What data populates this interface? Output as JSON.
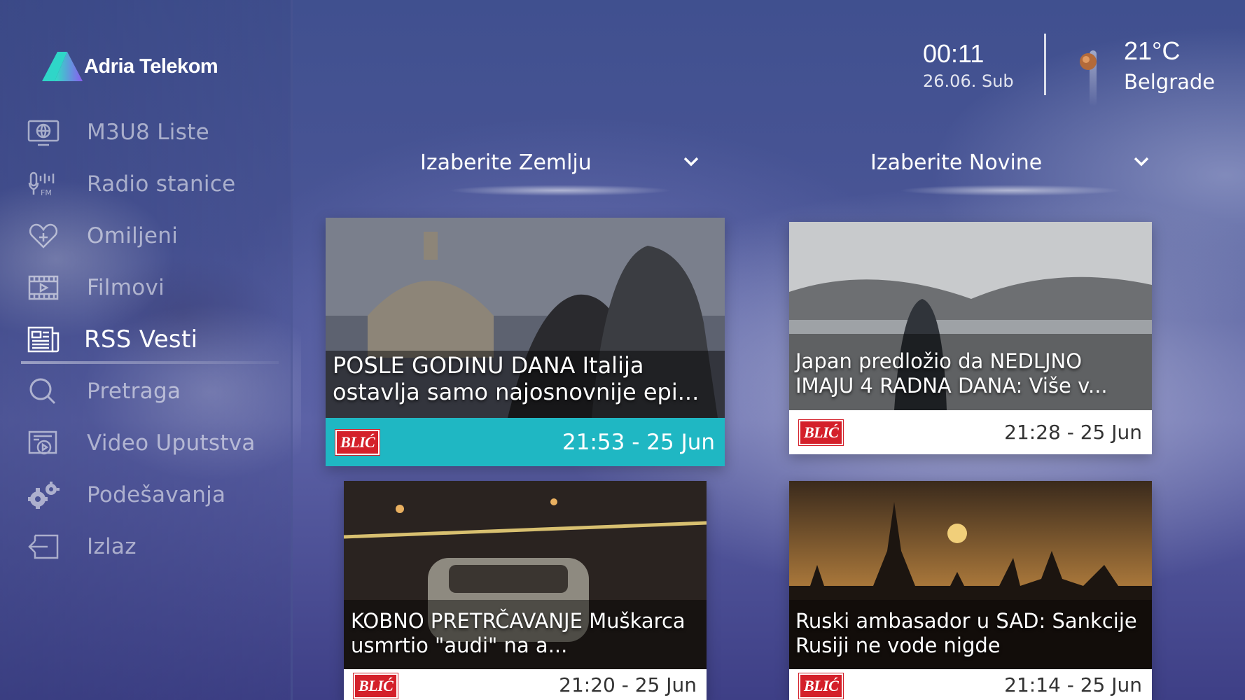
{
  "brand": {
    "name": "Adria Telekom"
  },
  "header": {
    "time": "00:11",
    "date": "26.06. Sub",
    "temperature": "21°C",
    "city": "Belgrade"
  },
  "sidebar": {
    "items": [
      {
        "label": "M3U8 Liste",
        "icon": "tv-globe-icon"
      },
      {
        "label": "Radio stanice",
        "icon": "radio-fm-icon"
      },
      {
        "label": "Omiljeni",
        "icon": "heart-plus-icon"
      },
      {
        "label": "Filmovi",
        "icon": "film-icon"
      },
      {
        "label": "RSS Vesti",
        "icon": "newspaper-icon",
        "active": true
      },
      {
        "label": "Pretraga",
        "icon": "search-icon"
      },
      {
        "label": "Video Uputstva",
        "icon": "video-guide-icon"
      },
      {
        "label": "Podešavanja",
        "icon": "gears-icon"
      },
      {
        "label": "Izlaz",
        "icon": "exit-icon"
      }
    ]
  },
  "filters": {
    "country_label": "Izaberite Zemlju",
    "paper_label": "Izaberite Novine"
  },
  "news": [
    {
      "headline": "POSLE GODINU DANA Italija ostavlja samo najosnovnije epi...",
      "source": "BLIĆ",
      "time": "21:53 - 25 Jun",
      "selected": true
    },
    {
      "headline": "Japan predložio da NEDLJNO IMAJU 4 RADNA DANA: Više v...",
      "source": "BLIĆ",
      "time": "21:28 - 25 Jun"
    },
    {
      "headline": "KOBNO PRETRČAVANJE Muškarca usmrtio \"audi\" na a...",
      "source": "BLIĆ",
      "time": "21:20 - 25 Jun"
    },
    {
      "headline": "Ruski ambasador u SAD: Sankcije Rusiji ne vode nigde",
      "source": "BLIĆ",
      "time": "21:14 - 25 Jun"
    }
  ],
  "colors": {
    "selected_card": "#1fb7c3",
    "source_badge": "#d4202a"
  }
}
